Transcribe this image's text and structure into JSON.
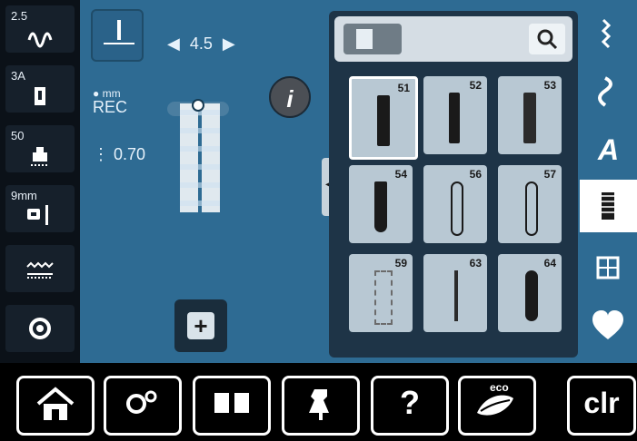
{
  "left_sidebar": {
    "stitch_width": "2.5",
    "presser_foot": "3A",
    "tension": "50",
    "needle": "9mm"
  },
  "main": {
    "buttonhole_length_value": "4.5",
    "measure_unit": "mm",
    "measure_mode": "REC",
    "spacing_value": "0.70"
  },
  "category_panel": {
    "tiles": [
      {
        "num": "51"
      },
      {
        "num": "52"
      },
      {
        "num": "53"
      },
      {
        "num": "54"
      },
      {
        "num": "56"
      },
      {
        "num": "57"
      },
      {
        "num": "59"
      },
      {
        "num": "63"
      },
      {
        "num": "64"
      }
    ]
  },
  "bottom_bar": {
    "eco_label": "eco",
    "clr_label": "clr",
    "help_label": "?"
  },
  "colors": {
    "main_blue": "#2e6b93",
    "panel_dark": "#1e3447",
    "tile_grey": "#b8c8d3",
    "highlight": "#ffffff"
  }
}
